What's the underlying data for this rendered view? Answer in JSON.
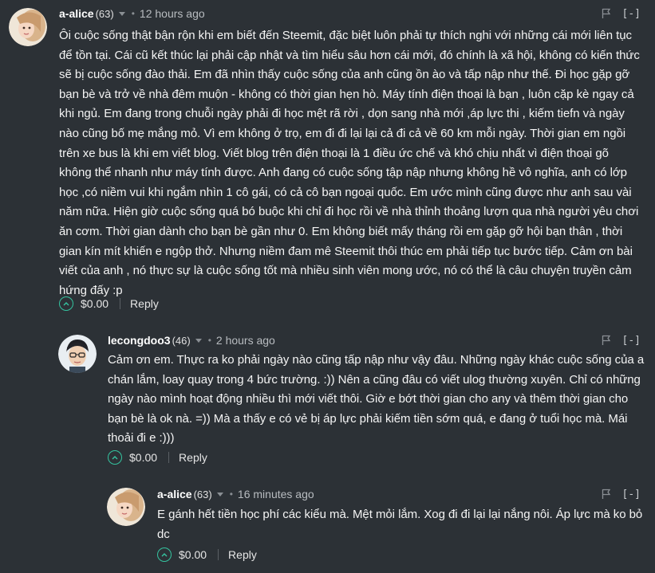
{
  "colors": {
    "background": "#2c3136",
    "upvote_accent": "#35c4a0",
    "muted": "#8a8f94"
  },
  "comments": [
    {
      "author": "a-alice",
      "reputation": "(63)",
      "time": "12 hours ago",
      "collapse_label": "[-]",
      "body_lines": [
        "Ôi cuộc sống thật bận rộn khi em biết đến Steemit, đặc biệt luôn phải tự thích nghi với những cái mới liên tục",
        "để tồn tại. Cái cũ kết thúc lại phải cập nhật và tìm hiểu sâu hơn cái mới, đó chính là xã hội, không có kiến thức",
        "sẽ bị cuộc sống đào thải. Em đã nhìn thấy cuộc sống của anh cũng ồn ào và tấp nập như thế. Đi học gặp gỡ",
        "bạn bè và trở về nhà đêm muộn - không có thời gian hẹn hò. Máy tính điện thoại là bạn , luôn cặp kè ngay cả",
        "khi ngủ. Em đang trong chuỗi ngày phải đi học mệt rã rời , dọn sang nhà mới ,áp lực thi , kiếm tiefn và ngày",
        "nào cũng bố mẹ mắng mỏ. Vì em không ở trọ, em đi đi lại lại cả đi cả về 60 km mỗi ngày. Thời gian em ngồi",
        "trên xe bus là khi em viết blog. Viết blog trên điện thoại là 1 điều ức chế và khó chịu nhất vì điện thoại gõ",
        "không thể nhanh như máy tính được. Anh đang có cuộc sống tập nập nhưng không hề vô nghĩa, anh có lớp",
        "học ,có niềm vui khi ngắm nhìn 1 cô gái, có cả cô bạn ngoại quốc. Em ước mình cũng được như anh sau vài",
        "năm nữa. Hiện giờ cuộc sống quá bó buộc khi chỉ đi học rồi về nhà thỉnh thoảng lượn qua nhà người yêu chơi",
        "ăn cơm. Thời gian dành cho bạn bè gần như 0. Em không biết mấy tháng rồi em gặp gỡ hội bạn thân , thời",
        "gian kín mít khiến e ngộp thở. Nhưng niềm đam mê Steemit thôi thúc em phải tiếp tục bước tiếp. Cảm ơn bài",
        "viết của anh , nó thực sự là cuộc sống tốt mà nhiều sinh viên mong ước, nó có thể là câu chuyện truyền cảm",
        "hứng đấy :p"
      ],
      "payout": "$0.00",
      "reply_label": "Reply"
    },
    {
      "author": "lecongdoo3",
      "reputation": "(46)",
      "time": "2 hours ago",
      "collapse_label": "[-]",
      "body_lines": [
        "Cảm ơn em. Thực ra ko phải ngày nào cũng tấp nập như vậy đâu. Những ngày khác cuộc sống của a",
        "chán lắm, loay quay trong 4 bức trường. :)) Nên a cũng đâu có viết ulog thường xuyên. Chỉ có những",
        "ngày nào mình hoạt động nhiều thì mới viết thôi. Giờ e bớt thời gian cho any và thêm thời gian cho",
        "bạn bè là ok nà. =)) Mà a thấy e có vẻ bị áp lực phải kiếm tiền sớm quá, e đang ở tuổi học mà. Mái",
        "thoải đi e :)))"
      ],
      "payout": "$0.00",
      "reply_label": "Reply"
    },
    {
      "author": "a-alice",
      "reputation": "(63)",
      "time": "16 minutes ago",
      "collapse_label": "[-]",
      "body_lines": [
        "E gánh hết tiền học phí các kiểu mà. Mệt mỏi lắm. Xog đi đi lại lại nắng nôi. Áp lực mà ko bỏ",
        "dc"
      ],
      "payout": "$0.00",
      "reply_label": "Reply"
    }
  ]
}
